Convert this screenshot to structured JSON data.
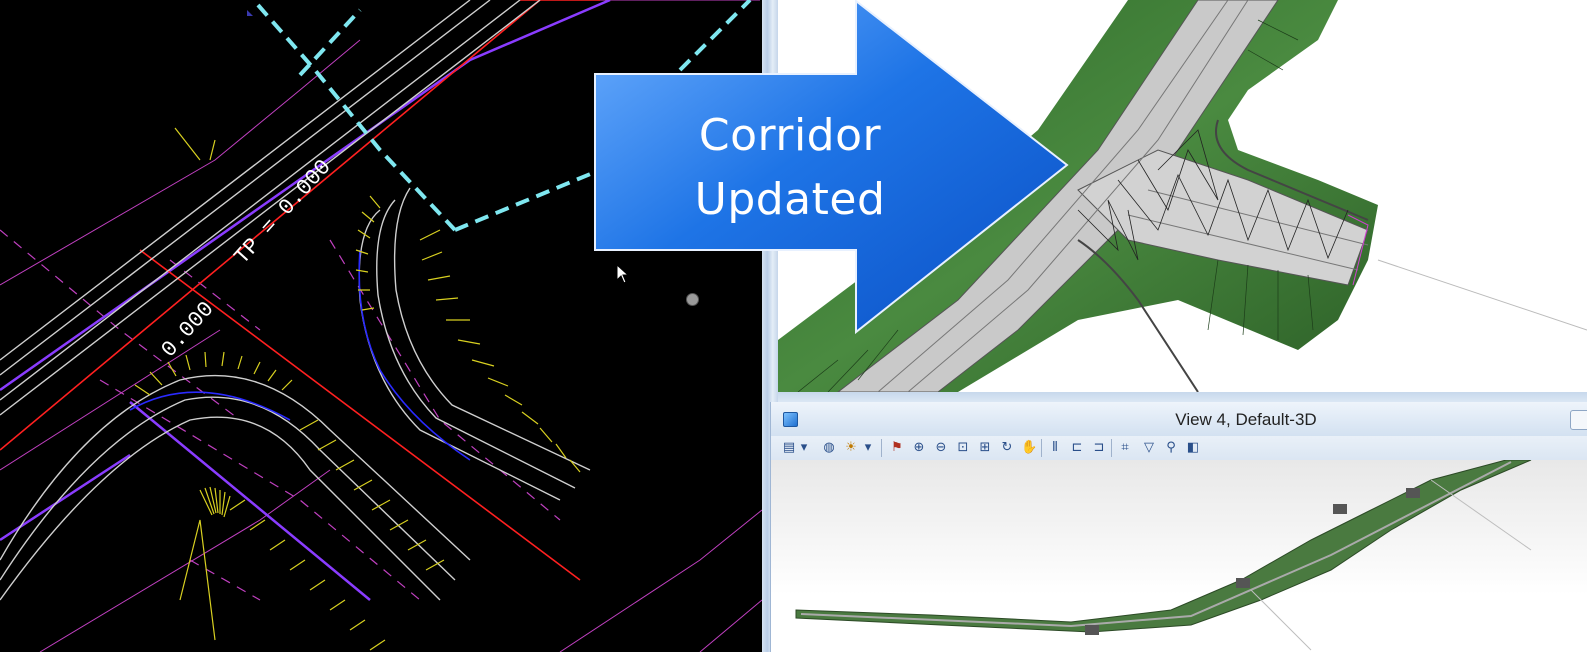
{
  "plan_view": {
    "label_tp": "TP = 0.000",
    "label_station": "0.000"
  },
  "callout": {
    "line1": "Corridor",
    "line2": "Updated"
  },
  "view4": {
    "title": "View 4, Default-3D",
    "toolbar_icons": [
      "view-attributes-icon",
      "dropdown-icon",
      "display-style-icon",
      "lighting-icon",
      "dropdown-icon",
      "pan-clip-icon",
      "zoom-in-icon",
      "zoom-out-icon",
      "window-area-icon",
      "fit-view-icon",
      "rotate-view-icon",
      "pan-view-icon",
      "walk-icon",
      "previous-view-icon",
      "next-view-icon",
      "view-clip-icon",
      "clip-volume-icon",
      "camera-icon",
      "render-icon"
    ]
  },
  "colors": {
    "plan_background": "#000000",
    "callout_blue": "#1a6fe0",
    "accent_cyan": "#7fe7f0",
    "road_grey": "#c8c8c8",
    "terrain_green": "#3e7a35"
  }
}
